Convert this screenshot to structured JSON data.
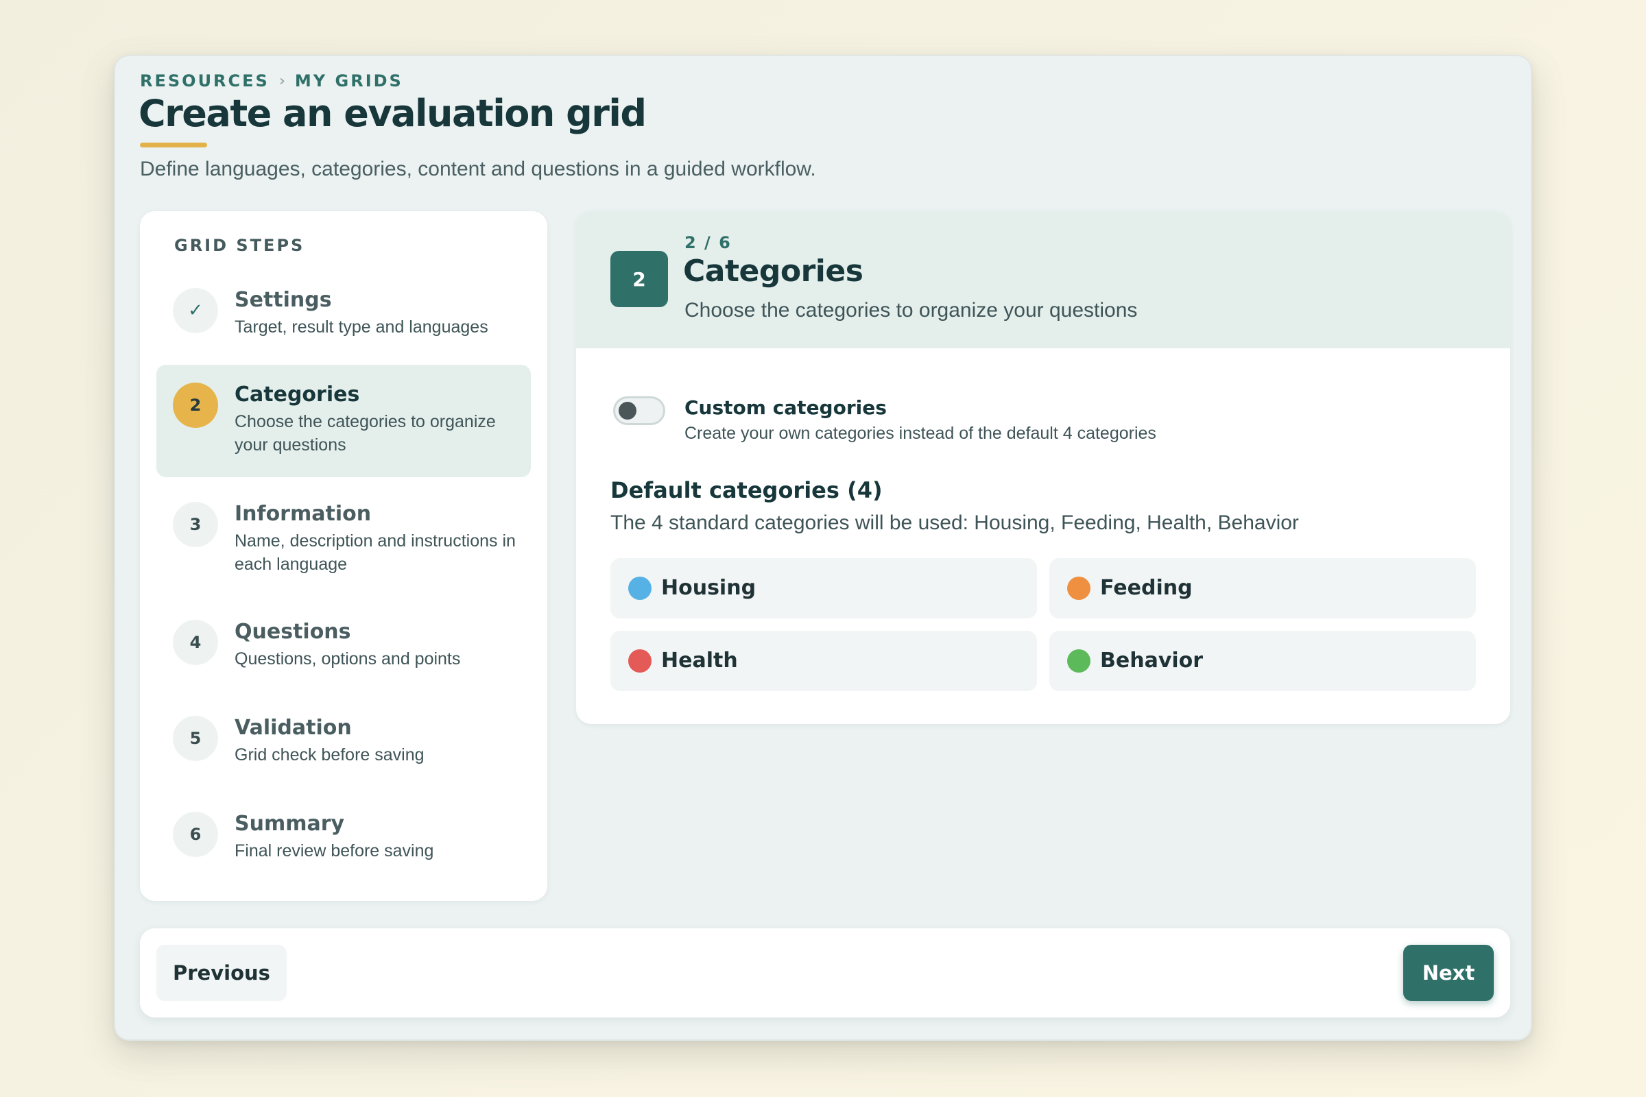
{
  "breadcrumb": {
    "root": "RESOURCES",
    "separator": "›",
    "current": "MY GRIDS"
  },
  "header": {
    "title": "Create an evaluation grid",
    "subtitle": "Define languages, categories, content and questions in a guided workflow."
  },
  "sidebar": {
    "heading": "GRID STEPS",
    "steps": [
      {
        "num": "✓",
        "label": "Settings",
        "desc": "Target, result type and languages",
        "state": "done"
      },
      {
        "num": "2",
        "label": "Categories",
        "desc": "Choose the categories to organize your questions",
        "state": "active"
      },
      {
        "num": "3",
        "label": "Information",
        "desc": "Name, description and instructions in each language",
        "state": "pending"
      },
      {
        "num": "4",
        "label": "Questions",
        "desc": "Questions, options and points",
        "state": "pending"
      },
      {
        "num": "5",
        "label": "Validation",
        "desc": "Grid check before saving",
        "state": "pending"
      },
      {
        "num": "6",
        "label": "Summary",
        "desc": "Final review before saving",
        "state": "pending"
      }
    ]
  },
  "main": {
    "badge": "2",
    "counter": "2 / 6",
    "title": "Categories",
    "description": "Choose the categories to organize your questions",
    "custom_toggle": {
      "title": "Custom categories",
      "desc": "Create your own categories instead of the default 4 categories",
      "enabled": false
    },
    "default_title": "Default categories (4)",
    "default_desc": "The 4 standard categories will be used: Housing, Feeding, Health, Behavior",
    "categories": [
      {
        "name": "Housing",
        "color": "#56b2e4"
      },
      {
        "name": "Feeding",
        "color": "#ef9040"
      },
      {
        "name": "Health",
        "color": "#e35a56"
      },
      {
        "name": "Behavior",
        "color": "#5cba5a"
      }
    ]
  },
  "footer": {
    "previous_label": "Previous",
    "next_label": "Next"
  },
  "colors": {
    "accent": "#2f7069",
    "highlight": "#e3b34a"
  }
}
